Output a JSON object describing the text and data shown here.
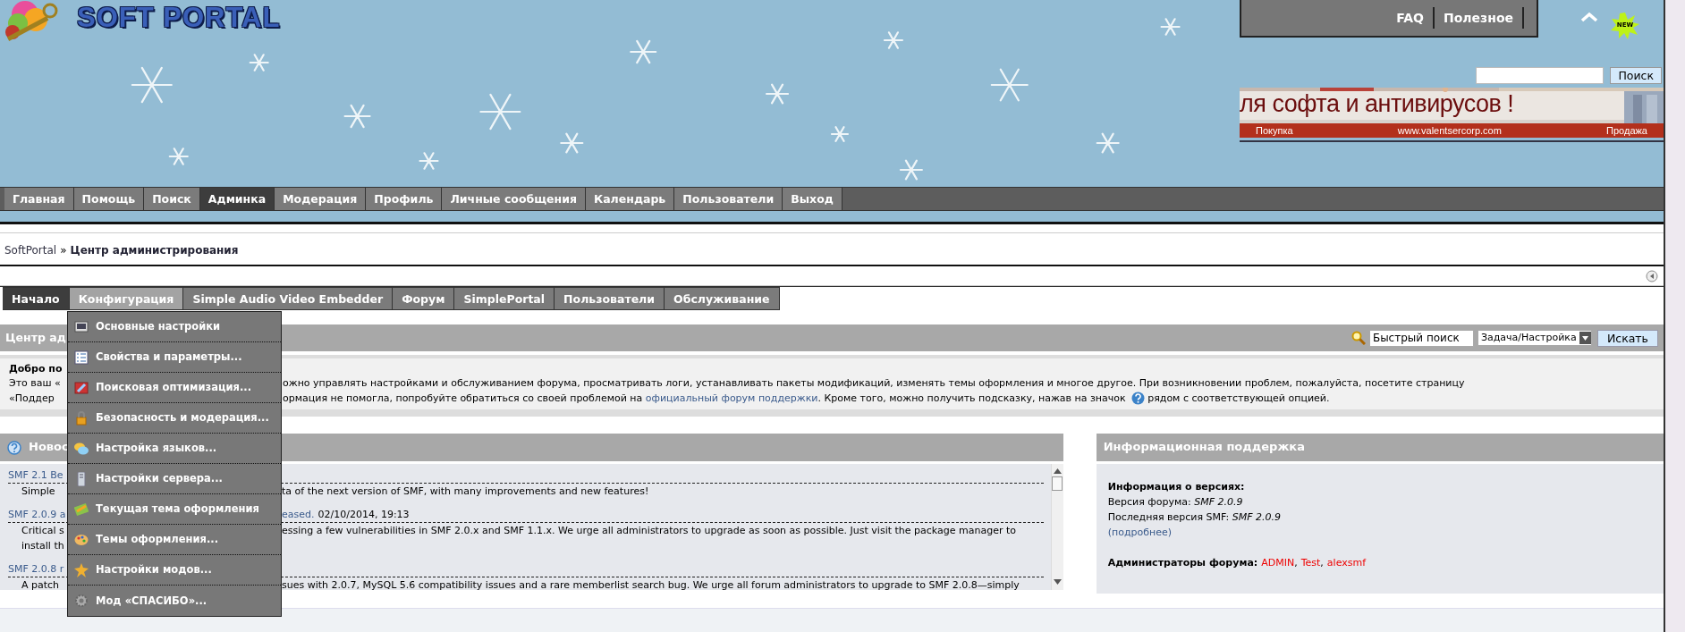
{
  "header": {
    "logo_text": "SOFT PORTAL",
    "top_links": [
      "FAQ",
      "Полезное"
    ],
    "new_badge": "NEW",
    "search": {
      "button": "Поиск"
    },
    "banner": {
      "headline": "ля софта и антивирусов !",
      "left": "Покупка",
      "url": "www.valentsercorp.com",
      "right": "Продажа"
    }
  },
  "main_nav": [
    {
      "label": "Главная",
      "selected": false
    },
    {
      "label": "Помощь",
      "selected": false
    },
    {
      "label": "Поиск",
      "selected": false
    },
    {
      "label": "Админка",
      "selected": true
    },
    {
      "label": "Модерация",
      "selected": false
    },
    {
      "label": "Профиль",
      "selected": false
    },
    {
      "label": "Личные сообщения",
      "selected": false
    },
    {
      "label": "Календарь",
      "selected": false
    },
    {
      "label": "Пользователи",
      "selected": false
    },
    {
      "label": "Выход",
      "selected": false
    }
  ],
  "breadcrumb": {
    "root": "SoftPortal",
    "separator": "»",
    "current": "Центр администрирования"
  },
  "admin_tabs": [
    {
      "label": "Начало",
      "selected": true,
      "expanded": false
    },
    {
      "label": "Конфигурация",
      "selected": false,
      "expanded": true
    },
    {
      "label": "Simple Audio Video Embedder",
      "selected": false,
      "expanded": false
    },
    {
      "label": "Форум",
      "selected": false,
      "expanded": false
    },
    {
      "label": "SimplePortal",
      "selected": false,
      "expanded": false
    },
    {
      "label": "Пользователи",
      "selected": false,
      "expanded": false
    },
    {
      "label": "Обслуживание",
      "selected": false,
      "expanded": false
    }
  ],
  "config_menu": [
    {
      "label": "Основные настройки"
    },
    {
      "label": "Свойства и параметры..."
    },
    {
      "label": "Поисковая оптимизация..."
    },
    {
      "label": "Безопасность и модерация..."
    },
    {
      "label": "Настройка языков..."
    },
    {
      "label": "Настройки сервера..."
    },
    {
      "label": "Текущая тема оформления"
    },
    {
      "label": "Темы оформления..."
    },
    {
      "label": "Настройки модов..."
    },
    {
      "label": "Мод «СПАСИБО»..."
    }
  ],
  "admin_center": {
    "title": "Центр ад",
    "quick_search": {
      "value": "Быстрый поиск",
      "select": "Задача/Настройка",
      "button": "Искать"
    }
  },
  "welcome": {
    "title": "Добро по",
    "line1": {
      "left": "Это ваш «",
      "right": "ожно управлять настройками и обслуживанием форума, просматривать логи, устанавливать пакеты модификаций, изменять темы оформления и многое другое. При возникновении проблем, пожалуйста, посетите страницу"
    },
    "line2": {
      "left": "«Поддер",
      "before": "ормация не помогла, попробуйте обратиться со своей проблемой на",
      "link": "официальный форум поддержки",
      "after": ". Кроме того, можно получить подсказку, нажав на значок",
      "end": "рядом с соответствующей опцией."
    }
  },
  "news": {
    "title": "Новос",
    "items": [
      {
        "title_left": "SMF 2.1 Be",
        "body": [
          {
            "left": "Simple",
            "right": "ta of the next version of SMF, with many improvements and new features!"
          }
        ]
      },
      {
        "title_left": "SMF 2.0.9 a",
        "title_right": "eased.",
        "date": "02/10/2014, 19:13",
        "body": [
          {
            "left": "Critical s",
            "right": "essing a few vulnerabilities in SMF 2.0.x and SMF 1.1.x. We urge all administrators to upgrade as soon as possible. Just visit the package manager to"
          },
          {
            "left": "install th"
          }
        ]
      },
      {
        "title_left": "SMF 2.0.8 r",
        "body": [
          {
            "left": "A patch",
            "right": "sues with 2.0.7, MySQL 5.6 compatibility issues and a rare memberlist search bug. We urge all forum administrators to upgrade to SMF 2.0.8—simply"
          }
        ]
      }
    ]
  },
  "info": {
    "title": "Информационная поддержка",
    "heading": "Информация о версиях:",
    "lines": [
      "Версия форума: *SMF 2.0.9*",
      "Последняя версия SMF: *SMF 2.0.9*"
    ],
    "more_link": "(подробнее)",
    "admins_label": "Администраторы форума:",
    "admins": [
      {
        "name": "ADMIN",
        "separator": ","
      },
      {
        "name": "Test",
        "separator": ","
      },
      {
        "name": "alexsmf"
      }
    ]
  }
}
